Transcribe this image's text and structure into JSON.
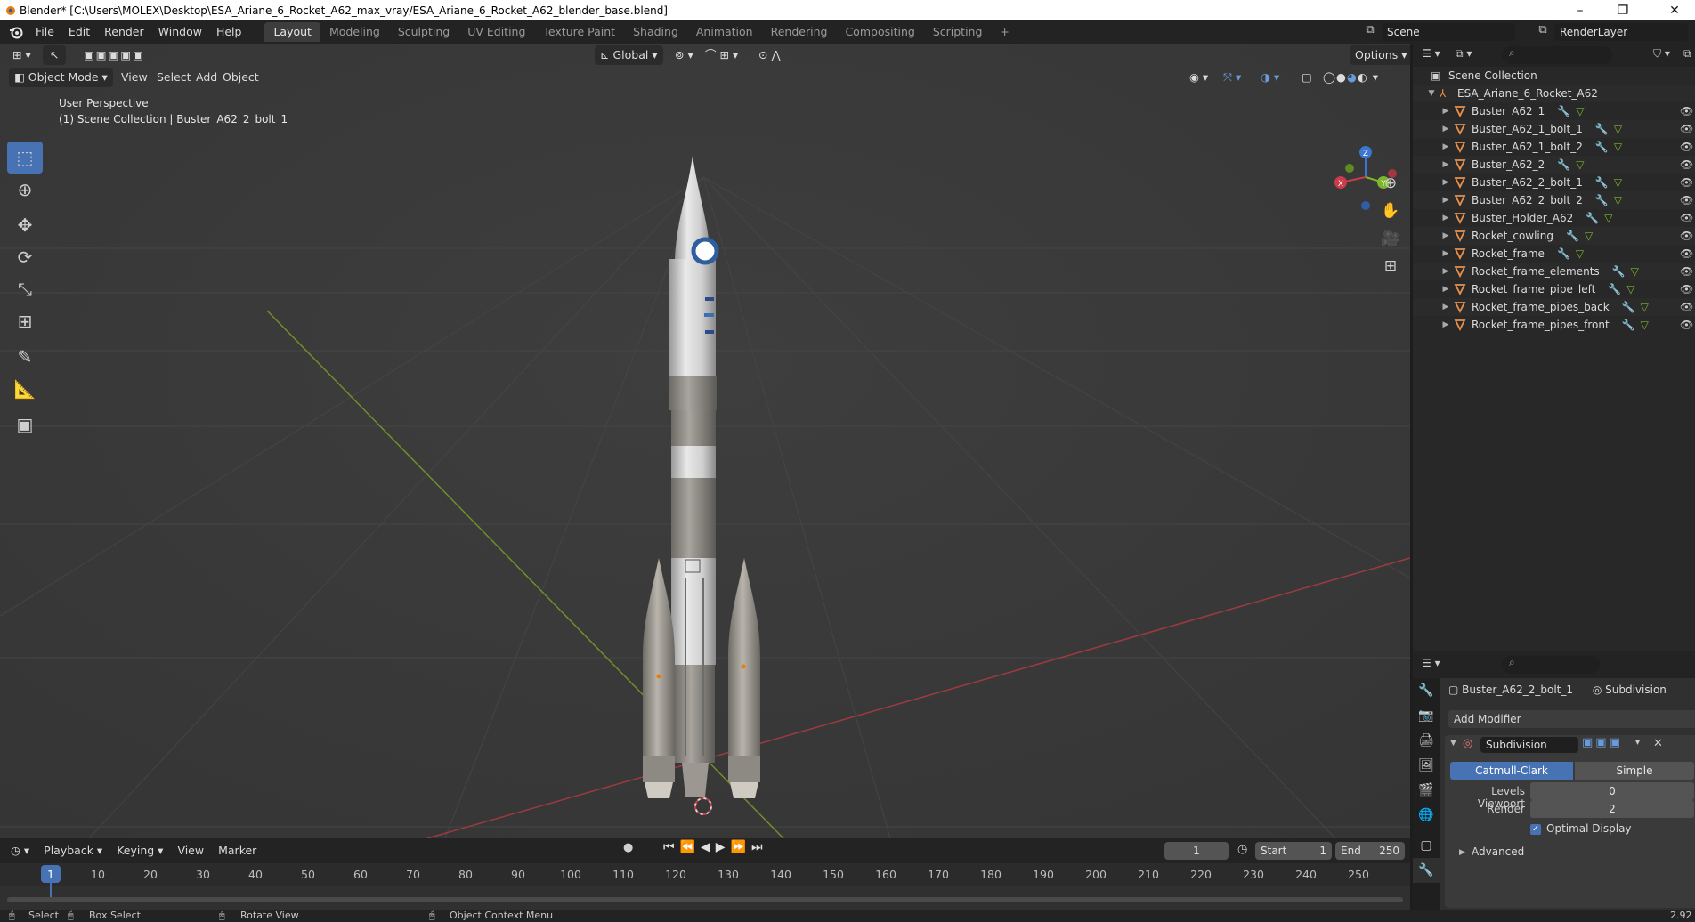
{
  "window": {
    "title": "Blender* [C:\\Users\\MOLEX\\Desktop\\ESA_Ariane_6_Rocket_A62_max_vray/ESA_Ariane_6_Rocket_A62_blender_base.blend]",
    "minimize": "–",
    "maximize": "❐",
    "close": "✕"
  },
  "menu": [
    "File",
    "Edit",
    "Render",
    "Window",
    "Help"
  ],
  "workspaces": [
    "Layout",
    "Modeling",
    "Sculpting",
    "UV Editing",
    "Texture Paint",
    "Shading",
    "Animation",
    "Rendering",
    "Compositing",
    "Scripting"
  ],
  "workspace_add": "+",
  "scene": {
    "name": "Scene",
    "render_layer": "RenderLayer"
  },
  "viewport": {
    "orientation": "Global",
    "options": "Options",
    "mode": "Object Mode",
    "menus": [
      "View",
      "Select",
      "Add",
      "Object"
    ],
    "overlay_line1": "User Perspective",
    "overlay_line2": "(1) Scene Collection | Buster_A62_2_bolt_1",
    "gizmo_axes": {
      "x": "X",
      "y": "Y",
      "z": "Z"
    }
  },
  "timeline": {
    "menus": [
      "Playback",
      "Keying",
      "View",
      "Marker"
    ],
    "current_frame": "1",
    "start_label": "Start",
    "start_value": "1",
    "end_label": "End",
    "end_value": "250",
    "ticks": [
      "1",
      "10",
      "20",
      "30",
      "40",
      "50",
      "60",
      "70",
      "80",
      "90",
      "100",
      "110",
      "120",
      "130",
      "140",
      "150",
      "160",
      "170",
      "180",
      "190",
      "200",
      "210",
      "220",
      "230",
      "240",
      "250"
    ]
  },
  "outliner": {
    "root": "Scene Collection",
    "collection": "ESA_Ariane_6_Rocket_A62",
    "items": [
      "Buster_A62_1",
      "Buster_A62_1_bolt_1",
      "Buster_A62_1_bolt_2",
      "Buster_A62_2",
      "Buster_A62_2_bolt_1",
      "Buster_A62_2_bolt_2",
      "Buster_Holder_A62",
      "Rocket_cowling",
      "Rocket_frame",
      "Rocket_frame_elements",
      "Rocket_frame_pipe_left",
      "Rocket_frame_pipes_back",
      "Rocket_frame_pipes_front"
    ]
  },
  "properties": {
    "object_name": "Buster_A62_2_bolt_1",
    "modifier_tab": "Subdivision",
    "add_modifier": "Add Modifier",
    "modifier_name": "Subdivision",
    "algo_catmull": "Catmull-Clark",
    "algo_simple": "Simple",
    "levels_viewport_label": "Levels Viewport",
    "levels_viewport_value": "0",
    "render_label": "Render",
    "render_value": "2",
    "optimal_display": "Optimal Display",
    "advanced": "Advanced"
  },
  "statusbar": {
    "select": "Select",
    "box_select": "Box Select",
    "rotate_view": "Rotate View",
    "context_menu": "Object Context Menu",
    "version": "2.92"
  },
  "colors": {
    "accent": "#4772b3",
    "x_axis": "#c93c4a",
    "y_axis": "#7db52c",
    "z_axis": "#3b76d1",
    "mesh_icon": "#e8904a"
  }
}
